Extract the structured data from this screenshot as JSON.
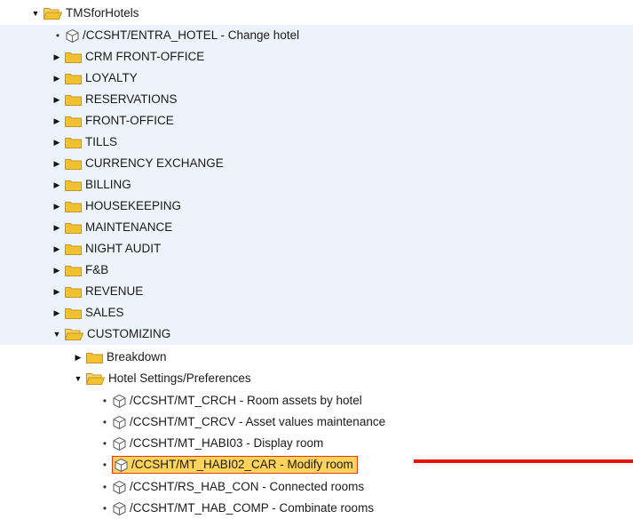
{
  "tree": {
    "root": {
      "label": "TMSforHotels",
      "icon": "folder-open-icon"
    },
    "top_transaction": {
      "label": "/CCSHT/ENTRA_HOTEL - Change hotel",
      "icon": "cube-icon"
    },
    "folders": [
      {
        "label": "CRM FRONT-OFFICE"
      },
      {
        "label": "LOYALTY"
      },
      {
        "label": "RESERVATIONS"
      },
      {
        "label": "FRONT-OFFICE"
      },
      {
        "label": "TILLS"
      },
      {
        "label": "CURRENCY EXCHANGE"
      },
      {
        "label": "BILLING"
      },
      {
        "label": "HOUSEKEEPING"
      },
      {
        "label": "MAINTENANCE"
      },
      {
        "label": "NIGHT AUDIT"
      },
      {
        "label": "F&B"
      },
      {
        "label": "REVENUE"
      },
      {
        "label": "SALES"
      }
    ],
    "customizing": {
      "label": "CUSTOMIZING",
      "breakdown": {
        "label": "Breakdown"
      },
      "hotel_settings": {
        "label": "Hotel Settings/Preferences",
        "transactions": [
          {
            "label": "/CCSHT/MT_CRCH - Room assets by hotel"
          },
          {
            "label": "/CCSHT/MT_CRCV - Asset values maintenance"
          },
          {
            "label": "/CCSHT/MT_HABI03 - Display room"
          },
          {
            "label": "/CCSHT/MT_HABI02_CAR - Modify room",
            "selected": true
          },
          {
            "label": "/CCSHT/RS_HAB_CON - Connected rooms"
          },
          {
            "label": "/CCSHT/MT_HAB_COMP - Combinate rooms"
          }
        ]
      }
    }
  },
  "colors": {
    "folder": "#f2c230",
    "selection": "#fdd35a",
    "selection_border": "#e03a1a",
    "annotation_line": "#e8130c",
    "alt_row": "#edf3fa"
  }
}
